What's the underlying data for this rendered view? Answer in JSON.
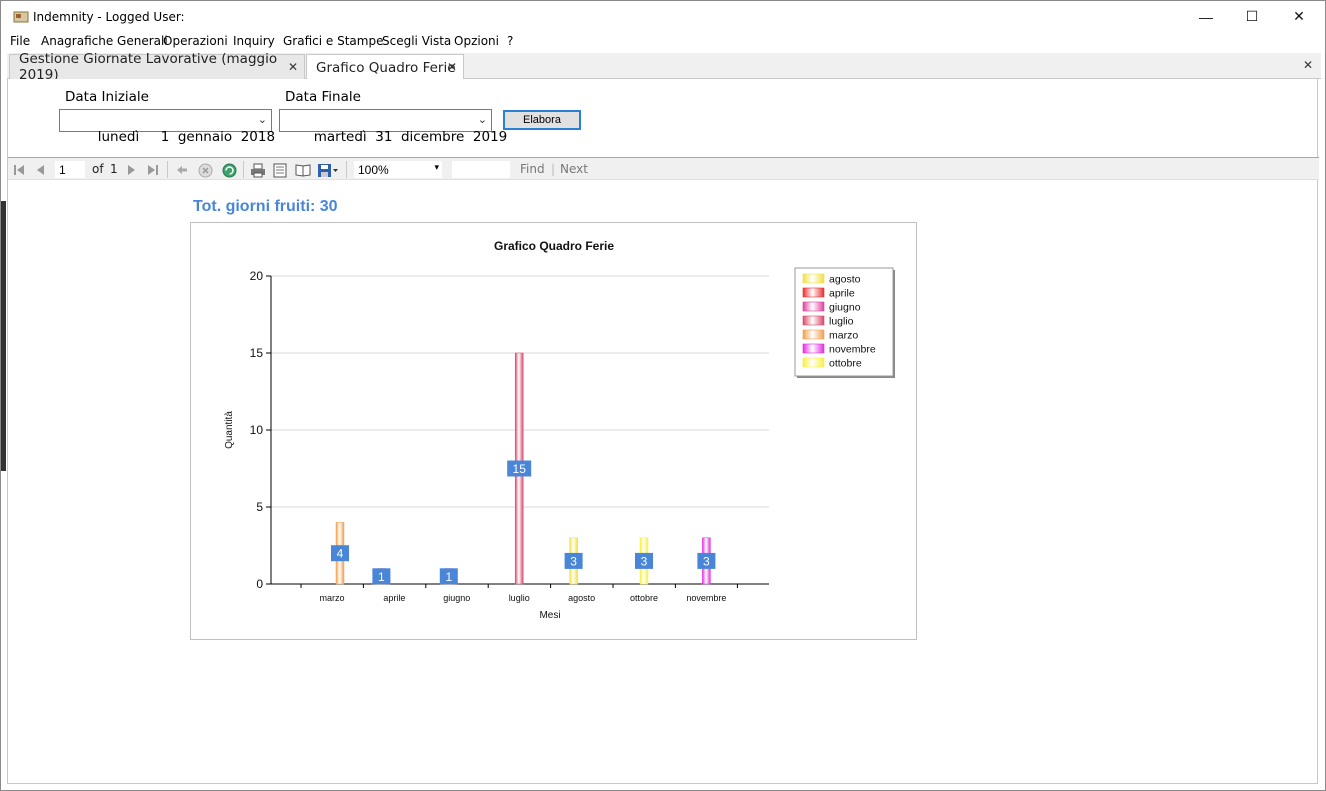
{
  "window": {
    "title": "Indemnity - Logged User:",
    "minimize": "—",
    "maximize": "☐",
    "close": "✕"
  },
  "menu": [
    "File",
    "Anagrafiche Generali",
    "Operazioni",
    "Inquiry",
    "Grafici e Stampe",
    "Scegli Vista",
    "Opzioni",
    "?"
  ],
  "tabs": [
    {
      "label": "Gestione Giornate Lavorative (maggio 2019)",
      "active": false
    },
    {
      "label": "Grafico Quadro Ferie",
      "active": true
    }
  ],
  "close_glyph": "✕",
  "form": {
    "start_label": "Data Iniziale",
    "start_value": "lunedì     1  gennaio  2018",
    "end_label": "Data Finale",
    "end_value": "martedì  31  dicembre  2019",
    "button": "Elabora"
  },
  "toolbar": {
    "page": "1",
    "of": "of",
    "total_pages": "1",
    "zoom": "100%",
    "find": "Find",
    "next": "Next",
    "sep": "|"
  },
  "report": {
    "total_label": "Tot. giorni fruiti:  30"
  },
  "chart_data": {
    "type": "bar",
    "title": "Grafico Quadro Ferie",
    "xlabel": "Mesi",
    "ylabel": "Quantità",
    "ylim": [
      0,
      20
    ],
    "yticks": [
      0,
      5,
      10,
      15,
      20
    ],
    "grid": true,
    "legend_position": "top-right",
    "categories": [
      "marzo",
      "aprile",
      "giugno",
      "luglio",
      "agosto",
      "ottobre",
      "novembre"
    ],
    "series": [
      {
        "name": "marzo",
        "category": "marzo",
        "value": 4,
        "color": "#f0a050"
      },
      {
        "name": "aprile",
        "category": "aprile",
        "value": 1,
        "color": "#e83030"
      },
      {
        "name": "giugno",
        "category": "giugno",
        "value": 1,
        "color": "#e040a0"
      },
      {
        "name": "luglio",
        "category": "luglio",
        "value": 15,
        "color": "#d84a6a"
      },
      {
        "name": "agosto",
        "category": "agosto",
        "value": 3,
        "color": "#f0e040"
      },
      {
        "name": "ottobre",
        "category": "ottobre",
        "value": 3,
        "color": "#f8f040"
      },
      {
        "name": "novembre",
        "category": "novembre",
        "value": 3,
        "color": "#e030e0"
      }
    ],
    "legend_order": [
      "agosto",
      "aprile",
      "giugno",
      "luglio",
      "marzo",
      "novembre",
      "ottobre"
    ],
    "label_color": "#4a86d8"
  }
}
